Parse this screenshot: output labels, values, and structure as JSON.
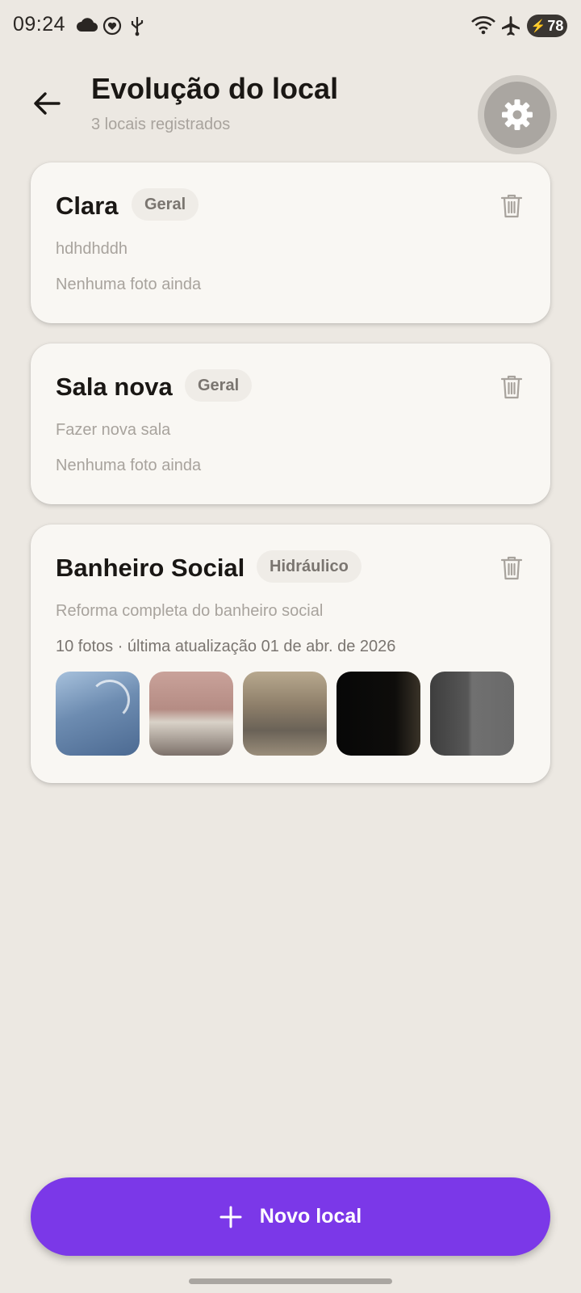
{
  "status_bar": {
    "time": "09:24",
    "battery": "78",
    "icons": [
      "cloud-icon",
      "heart-badge-icon",
      "usb-icon",
      "wifi-icon",
      "airplane-icon",
      "battery-icon"
    ]
  },
  "header": {
    "title": "Evolução do local",
    "subtitle": "3 locais registrados",
    "back_icon": "arrow-left-icon",
    "settings_icon": "gear-icon"
  },
  "locations": [
    {
      "name": "Clara",
      "tag": "Geral",
      "description": "hdhdhddh",
      "meta": "Nenhuma foto ainda"
    },
    {
      "name": "Sala nova",
      "tag": "Geral",
      "description": "Fazer nova sala",
      "meta": "Nenhuma foto ainda"
    },
    {
      "name": "Banheiro Social",
      "tag": "Hidráulico",
      "description": "Reforma completa do banheiro social",
      "meta": "10 fotos · última atualização 01 de abr. de 2026",
      "photos": [
        "shower-photo",
        "bathtub-demolition-photo",
        "bathtub-wall-photo",
        "dark-photo",
        "gray-surface-photo"
      ]
    }
  ],
  "new_button": {
    "label": "Novo local",
    "icon": "plus-icon"
  },
  "colors": {
    "background": "#ece8e2",
    "card": "#f9f7f3",
    "accent": "#7b38e8",
    "muted_text": "#a8a39d"
  }
}
